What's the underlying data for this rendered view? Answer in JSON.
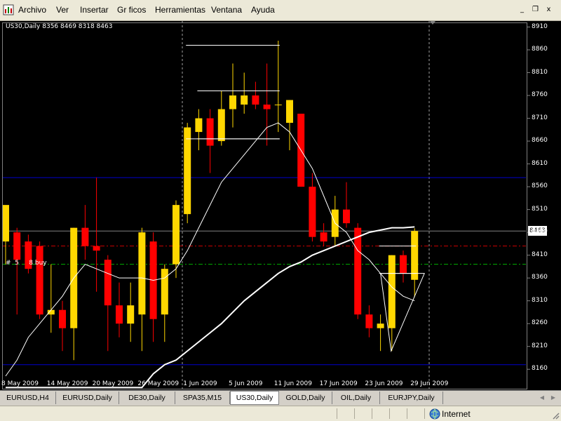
{
  "menu": {
    "items": [
      "Archivo",
      "Ver",
      "Insertar",
      "Gr ficos",
      "Herramientas",
      "Ventana",
      "Ayuda"
    ]
  },
  "window_controls": {
    "minimize": "_",
    "restore": "❐",
    "close": "x"
  },
  "chart_header": "US30,Daily  8356 8469 8318 8463",
  "order_label": "#  5     8 buy",
  "current_price": "8463",
  "icons": {
    "app": "chart-window-icon",
    "internet": "globe-icon"
  },
  "colors": {
    "bull": "#ffd700",
    "bear": "#ff0000",
    "ma": "#ffffff",
    "channel": "#0000cd",
    "order_line": "#cd0000",
    "stop_line": "#00b000"
  },
  "chart_data": {
    "type": "candlestick",
    "symbol": "US30",
    "timeframe": "Daily",
    "header_values": {
      "open": 8356,
      "high": 8469,
      "low": 8318,
      "close": 8463
    },
    "ylim": [
      8145,
      8920
    ],
    "yticks": [
      8910,
      8860,
      8810,
      8760,
      8710,
      8660,
      8610,
      8560,
      8510,
      8460,
      8410,
      8360,
      8310,
      8260,
      8210,
      8160
    ],
    "xticks": [
      {
        "label": "8 May 2009",
        "index": 0
      },
      {
        "label": "14 May 2009",
        "index": 4
      },
      {
        "label": "20 May 2009",
        "index": 8
      },
      {
        "label": "26 May 2009",
        "index": 12
      },
      {
        "label": "1 Jun 2009",
        "index": 16
      },
      {
        "label": "5 Jun 2009",
        "index": 20
      },
      {
        "label": "11 Jun 2009",
        "index": 24
      },
      {
        "label": "17 Jun 2009",
        "index": 28
      },
      {
        "label": "23 Jun 2009",
        "index": 32
      },
      {
        "label": "29 Jun 2009",
        "index": 36
      }
    ],
    "candles": [
      {
        "o": 8440,
        "h": 8480,
        "l": 8390,
        "c": 8520
      },
      {
        "o": 8460,
        "h": 8470,
        "l": 8280,
        "c": 8400
      },
      {
        "o": 8440,
        "h": 8455,
        "l": 8370,
        "c": 8380
      },
      {
        "o": 8430,
        "h": 8440,
        "l": 8270,
        "c": 8280
      },
      {
        "o": 8280,
        "h": 8390,
        "l": 8240,
        "c": 8290
      },
      {
        "o": 8290,
        "h": 8310,
        "l": 8200,
        "c": 8250
      },
      {
        "o": 8250,
        "h": 8470,
        "l": 8180,
        "c": 8470
      },
      {
        "o": 8470,
        "h": 8520,
        "l": 8400,
        "c": 8430
      },
      {
        "o": 8430,
        "h": 8580,
        "l": 8330,
        "c": 8420
      },
      {
        "o": 8400,
        "h": 8410,
        "l": 8200,
        "c": 8300
      },
      {
        "o": 8300,
        "h": 8350,
        "l": 8230,
        "c": 8260
      },
      {
        "o": 8260,
        "h": 8350,
        "l": 8220,
        "c": 8300
      },
      {
        "o": 8280,
        "h": 8470,
        "l": 8200,
        "c": 8460
      },
      {
        "o": 8440,
        "h": 8460,
        "l": 8220,
        "c": 8270
      },
      {
        "o": 8280,
        "h": 8390,
        "l": 8220,
        "c": 8380
      },
      {
        "o": 8390,
        "h": 8530,
        "l": 8360,
        "c": 8520
      },
      {
        "o": 8500,
        "h": 8700,
        "l": 8480,
        "c": 8690
      },
      {
        "o": 8680,
        "h": 8730,
        "l": 8640,
        "c": 8710
      },
      {
        "o": 8710,
        "h": 8730,
        "l": 8590,
        "c": 8650
      },
      {
        "o": 8660,
        "h": 8770,
        "l": 8650,
        "c": 8730
      },
      {
        "o": 8730,
        "h": 8830,
        "l": 8690,
        "c": 8760
      },
      {
        "o": 8740,
        "h": 8810,
        "l": 8720,
        "c": 8760
      },
      {
        "o": 8760,
        "h": 8790,
        "l": 8730,
        "c": 8740
      },
      {
        "o": 8740,
        "h": 8830,
        "l": 8650,
        "c": 8730
      },
      {
        "o": 8740,
        "h": 8880,
        "l": 8680,
        "c": 8740
      },
      {
        "o": 8700,
        "h": 8750,
        "l": 8640,
        "c": 8750
      },
      {
        "o": 8720,
        "h": 8720,
        "l": 8560,
        "c": 8560
      },
      {
        "o": 8560,
        "h": 8590,
        "l": 8440,
        "c": 8450
      },
      {
        "o": 8460,
        "h": 8480,
        "l": 8430,
        "c": 8440
      },
      {
        "o": 8450,
        "h": 8540,
        "l": 8430,
        "c": 8510
      },
      {
        "o": 8510,
        "h": 8570,
        "l": 8470,
        "c": 8480
      },
      {
        "o": 8470,
        "h": 8480,
        "l": 8270,
        "c": 8280
      },
      {
        "o": 8280,
        "h": 8300,
        "l": 8230,
        "c": 8250
      },
      {
        "o": 8250,
        "h": 8280,
        "l": 8200,
        "c": 8260
      },
      {
        "o": 8250,
        "h": 8410,
        "l": 8200,
        "c": 8410
      },
      {
        "o": 8410,
        "h": 8420,
        "l": 8350,
        "c": 8370
      },
      {
        "o": 8356,
        "h": 8469,
        "l": 8318,
        "c": 8463
      }
    ],
    "ma_fast": [
      8145,
      8180,
      8230,
      8260,
      8290,
      8320,
      8360,
      8390,
      8380,
      8370,
      8360,
      8360,
      8360,
      8355,
      8360,
      8380,
      8420,
      8470,
      8520,
      8570,
      8600,
      8630,
      8660,
      8690,
      8700,
      8680,
      8640,
      8600,
      8540,
      8480,
      8460,
      8420,
      8400,
      8370,
      8340,
      8320,
      8310
    ],
    "ma_slow": [
      8120,
      8120,
      8120,
      8120,
      8120,
      8120,
      8120,
      8120,
      8120,
      8120,
      8120,
      8120,
      8120,
      8150,
      8170,
      8180,
      8200,
      8220,
      8240,
      8260,
      8285,
      8310,
      8330,
      8350,
      8370,
      8385,
      8395,
      8410,
      8420,
      8430,
      8440,
      8450,
      8460,
      8465,
      8470,
      8470,
      8472
    ],
    "hlines": [
      {
        "name": "channel-top",
        "value": 8580,
        "color": "#0000cd"
      },
      {
        "name": "channel-bottom",
        "value": 8170,
        "color": "#0000cd"
      },
      {
        "name": "current-price",
        "value": 8463,
        "color": "#808080"
      },
      {
        "name": "order-price",
        "value": 8430,
        "color": "#cd0000"
      },
      {
        "name": "stop-level",
        "value": 8390,
        "color": "#00b000"
      }
    ],
    "grid": false
  },
  "tabs": [
    {
      "label": "EURUSD,H4",
      "active": false
    },
    {
      "label": "EURUSD,Daily",
      "active": false
    },
    {
      "label": "DE30,Daily",
      "active": false
    },
    {
      "label": "SPA35,M15",
      "active": false
    },
    {
      "label": "US30,Daily",
      "active": true
    },
    {
      "label": "GOLD,Daily",
      "active": false
    },
    {
      "label": "OIL,Daily",
      "active": false
    },
    {
      "label": "EURJPY,Daily",
      "active": false
    }
  ],
  "status": {
    "zone": "Internet"
  }
}
